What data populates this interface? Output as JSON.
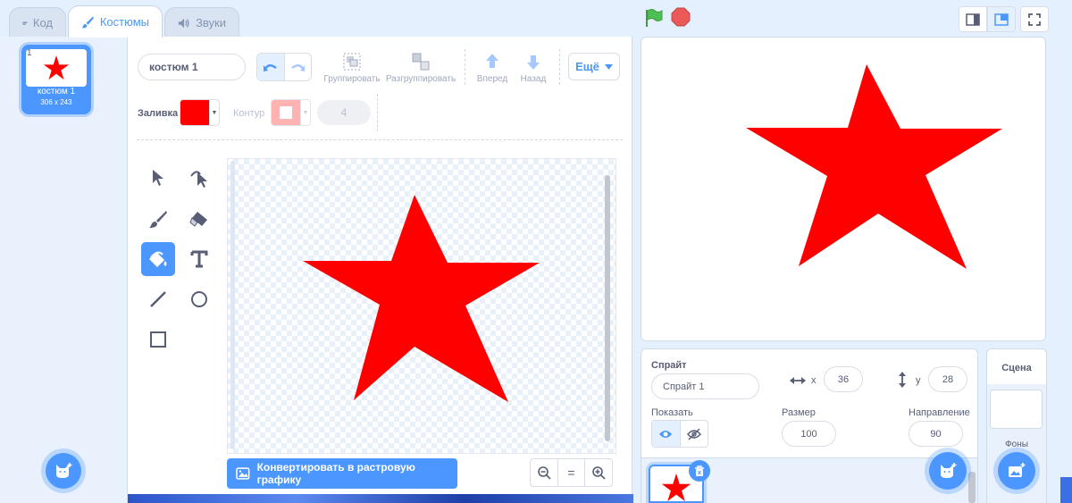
{
  "tabs": [
    {
      "label": "Код",
      "icon": "code-icon"
    },
    {
      "label": "Костюмы",
      "icon": "brush-icon"
    },
    {
      "label": "Звуки",
      "icon": "speaker-icon"
    }
  ],
  "costumes": [
    {
      "number": "1",
      "name": "костюм 1",
      "size": "306 x 243"
    }
  ],
  "editor": {
    "costume_name": "костюм 1",
    "group_label": "Группировать",
    "ungroup_label": "Разгруппировать",
    "forward_label": "Вперед",
    "backward_label": "Назад",
    "more_label": "Ещё",
    "fill_label": "Заливка",
    "outline_label": "Контур",
    "outline_width": "4",
    "fill_color": "#ff0000",
    "outline_color": "#ff9999",
    "convert_label": "Конвертировать в растровую графику",
    "zoom_reset": "="
  },
  "sprite": {
    "section_label": "Спрайт",
    "name": "Спрайт 1",
    "x_label": "x",
    "x": "36",
    "y_label": "y",
    "y": "28",
    "show_label": "Показать",
    "size_label": "Размер",
    "size": "100",
    "direction_label": "Направление",
    "direction": "90"
  },
  "stage": {
    "scene_label": "Сцена",
    "backdrops_label": "Фоны"
  },
  "colors": {
    "accent": "#4c97ff",
    "star": "#ff0000",
    "green_flag": "#4cbf56",
    "stop": "#ec5959"
  }
}
